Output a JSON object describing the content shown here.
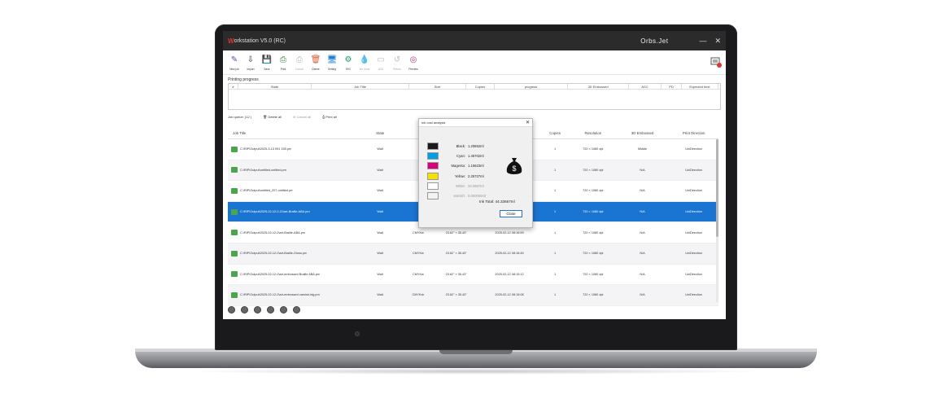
{
  "app": {
    "title_logo_letter": "W",
    "title": "orkstation V5.0 (RC)",
    "brand": "Orbs.Jet",
    "minimize": "—",
    "close": "✕"
  },
  "toolbar": [
    {
      "label": "New job",
      "icon": "new-job-icon",
      "color": "#6b3fa0",
      "disabled": false
    },
    {
      "label": "Import",
      "icon": "import-icon",
      "color": "#333333",
      "disabled": false
    },
    {
      "label": "Save",
      "icon": "save-icon",
      "color": "#1f5fbf",
      "disabled": false
    },
    {
      "label": "Print",
      "icon": "print-icon",
      "color": "#2e8b3e",
      "disabled": false
    },
    {
      "label": "Cancel",
      "icon": "cancel-print-icon",
      "color": "#bbbbbb",
      "disabled": true
    },
    {
      "label": "Delete",
      "icon": "delete-icon",
      "color": "#e05a2b",
      "disabled": false
    },
    {
      "label": "Setting",
      "icon": "setting-icon",
      "color": "#1b7fd6",
      "disabled": false
    },
    {
      "label": "RIG",
      "icon": "rig-icon",
      "color": "#1a9a6a",
      "disabled": false
    },
    {
      "label": "Ink Level",
      "icon": "ink-level-icon",
      "color": "#999999",
      "disabled": true
    },
    {
      "label": "ACE",
      "icon": "ace-icon",
      "color": "#bbbbbb",
      "disabled": true
    },
    {
      "label": "Return",
      "icon": "return-icon",
      "color": "#bbbbbb",
      "disabled": true
    },
    {
      "label": "Preview",
      "icon": "preview-icon",
      "color": "#c2387a",
      "disabled": false
    }
  ],
  "progress": {
    "title": "Printing progress",
    "columns": [
      "#",
      "State",
      "Job Title",
      "Size",
      "Copies",
      "progress",
      "3D Embossed",
      "ASC",
      "PD",
      "Expected time"
    ]
  },
  "queue": {
    "title": "Job queue: (12 )",
    "delete_all": "Delete all",
    "cancel_all": "Cancel all",
    "print_all": "Print all",
    "columns": [
      "Job Title",
      "State",
      "",
      "",
      "ed",
      "Copies",
      "Resolution",
      "3D Embossed",
      "Print Direction"
    ],
    "rows": [
      {
        "title": "C:\\RIP\\Output\\2025-3-13 091 155.prn",
        "state": "Wait",
        "ink": "",
        "size": "",
        "time": "0:22",
        "copies": "1",
        "res": "720 × 1080 dpi",
        "emboss": "Middle",
        "dir": "UniDirection"
      },
      {
        "title": "C:\\RIP\\Output\\untitled-untitled.prn",
        "state": "Wait",
        "ink": "",
        "size": "",
        "time": "0:08",
        "copies": "1",
        "res": "720 × 1080 dpi",
        "emboss": "N/A",
        "dir": "UniDirection"
      },
      {
        "title": "C:\\RIP\\Output\\untitled_207-untitled.prn",
        "state": "Wait",
        "ink": "",
        "size": "",
        "time": "0:49",
        "copies": "1",
        "res": "720 × 1080 dpi",
        "emboss": "N/A",
        "dir": "UniDirection"
      },
      {
        "title": "C:\\RIP\\Output\\2025-02-12-0-21\\art-Braille-ABA.prn",
        "state": "Wait",
        "ink": "",
        "size": "",
        "time": "0:04",
        "copies": "1",
        "res": "720 × 1080 dpi",
        "emboss": "N/A",
        "dir": "UniDirection"
      },
      {
        "title": "C:\\RIP\\Output\\2025-02-12-0\\art-Braille-ABA.prn",
        "state": "Wait",
        "ink": "CMYKw",
        "size": "23.62\" × 35.43\"",
        "time": "2025-02-12 08:16:59",
        "copies": "1",
        "res": "720 × 1080 dpi",
        "emboss": "N/A",
        "dir": "UniDirection"
      },
      {
        "title": "C:\\RIP\\Output\\2025-02-12-0\\art-Braille-Gloss.prn",
        "state": "Wait",
        "ink": "CMYKw",
        "size": "23.62\" × 35.43\"",
        "time": "2025-02-12 08:16:45",
        "copies": "1",
        "res": "720 × 1080 dpi",
        "emboss": "N/A",
        "dir": "UniDirection"
      },
      {
        "title": "C:\\RIP\\Output\\2025-02-12-0\\art-embossed Braille ABA.prn",
        "state": "Wait",
        "ink": "CMYKw",
        "size": "23.62\" × 35.43\"",
        "time": "2025-02-12 08:15:12",
        "copies": "1",
        "res": "720 × 1080 dpi",
        "emboss": "N/A",
        "dir": "UniDirection"
      },
      {
        "title": "C:\\RIP\\Output\\2025-02-12-0\\art-embossed varnish-big.prn",
        "state": "Wait",
        "ink": "CMYKvk",
        "size": "23.62\" × 35.43\"",
        "time": "2025-02-12 08:15:08",
        "copies": "1",
        "res": "720 × 1080 dpi",
        "emboss": "N/A",
        "dir": "UniDirection"
      }
    ],
    "selected_index": 3
  },
  "dialog": {
    "title": "Ink cost analysis",
    "close": "✕",
    "inks": [
      {
        "name": "Black:",
        "value": "1.20652ml",
        "color": "#1a1a1a",
        "disabled": false
      },
      {
        "name": "Cyan:",
        "value": "1.45702ml",
        "color": "#00a0e6",
        "disabled": false
      },
      {
        "name": "Magenta:",
        "value": "1.15623ml",
        "color": "#d6007a",
        "disabled": false
      },
      {
        "name": "Yellow:",
        "value": "2.25727ml",
        "color": "#f5e100",
        "disabled": false
      },
      {
        "name": "White:",
        "value": "33.0667ml",
        "color": "#ffffff",
        "disabled": true
      },
      {
        "name": "Varnish:",
        "value": "0.000000ml",
        "color": "#f3f3f3",
        "disabled": true
      }
    ],
    "total_label": "Ink Total:",
    "total_value": "44.33667ml",
    "close_button": "Close"
  },
  "colors": {
    "selected_row": "#1a74d2",
    "titlebar": "#2b2b2b",
    "accent": "#e8322b"
  }
}
